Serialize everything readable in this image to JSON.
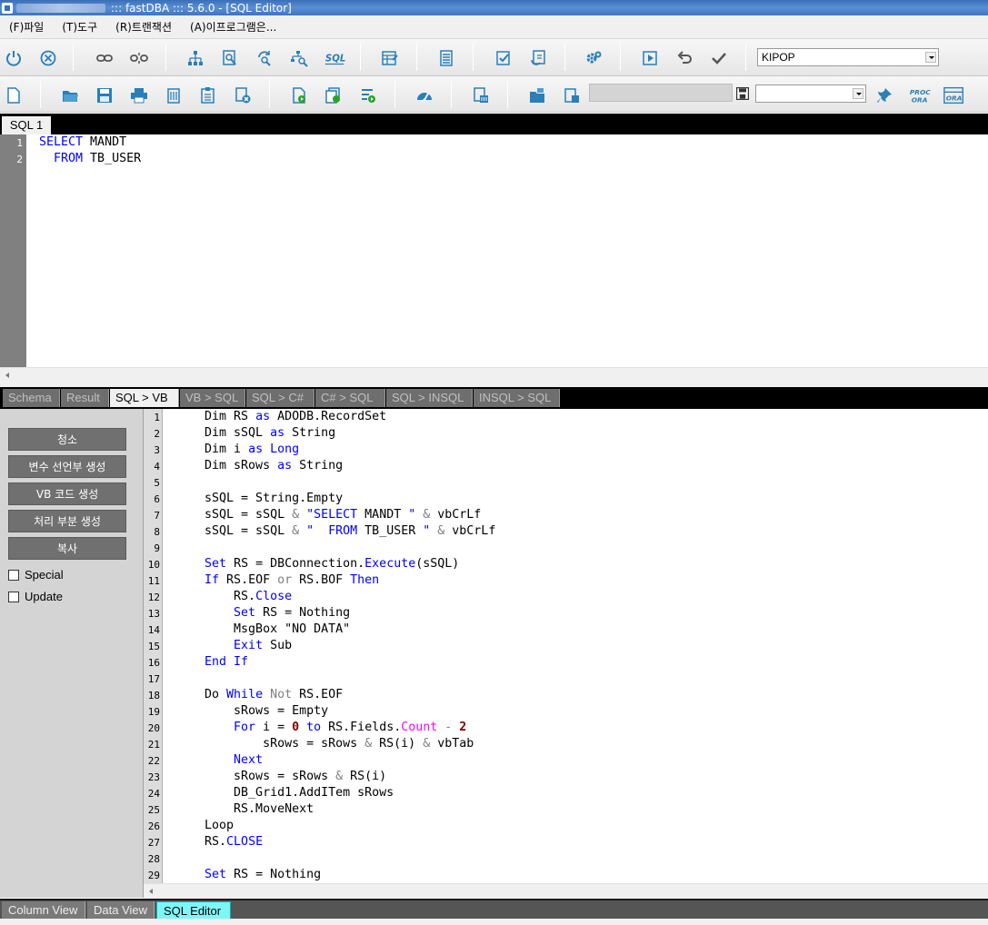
{
  "window": {
    "title": "::: fastDBA ::: 5.6.0 - [SQL Editor]"
  },
  "menu": [
    {
      "label": "(F)파일"
    },
    {
      "label": "(T)도구"
    },
    {
      "label": "(R)트랜잭션"
    },
    {
      "label": "(A)이프로그램은..."
    }
  ],
  "toolbar1": {
    "icons": [
      "power-icon",
      "cancel-icon",
      "connect-icon",
      "disconnect-icon",
      "tree-icon",
      "find-object-icon",
      "refresh-search-icon",
      "search-tree-icon",
      "sql-icon",
      "table-edit-icon",
      "list-icon",
      "check-doc-icon",
      "sync-doc-icon",
      "settings-icon",
      "run-icon",
      "undo-icon",
      "commit-icon"
    ],
    "connection_select": {
      "value": "KIPOP"
    }
  },
  "toolbar2": {
    "icons": [
      "new-icon",
      "open-icon",
      "save-icon",
      "print-icon",
      "delete-icon",
      "paste-icon",
      "clear-icon",
      "new-run-icon",
      "run-all-icon",
      "run-step-icon",
      "gauge-icon",
      "trash-icon",
      "folder-open-icon",
      "copy-doc-icon",
      "save-small-icon",
      "pin-icon",
      "proc-ora-icon",
      "ora-icon"
    ],
    "path_field": {
      "value": ""
    },
    "second_select": {
      "value": ""
    },
    "proc_label": "PROC",
    "ora_label": "ORA"
  },
  "sql_tabs": [
    {
      "label": "SQL 1"
    }
  ],
  "sql_editor": {
    "lines": [
      {
        "n": "1",
        "html": "<span class=\"kw\">SELECT</span> MANDT"
      },
      {
        "n": "2",
        "html": "  <span class=\"kw\">FROM</span> TB_USER"
      }
    ]
  },
  "bottom_tabs": [
    {
      "label": "Schema",
      "active": false
    },
    {
      "label": "Result",
      "active": false
    },
    {
      "label": "SQL > VB",
      "active": true
    },
    {
      "label": "VB > SQL",
      "active": false
    },
    {
      "label": "SQL > C#",
      "active": false
    },
    {
      "label": "C# > SQL",
      "active": false
    },
    {
      "label": "SQL > INSQL",
      "active": false
    },
    {
      "label": "INSQL > SQL",
      "active": false
    }
  ],
  "left_panel": {
    "buttons": [
      {
        "label": "청소"
      },
      {
        "label": "변수 선언부 생성"
      },
      {
        "label": "VB 코드 생성"
      },
      {
        "label": "처리 부분 생성"
      },
      {
        "label": "복사"
      }
    ],
    "checkboxes": [
      {
        "label": "Special",
        "checked": false
      },
      {
        "label": "Update",
        "checked": false
      }
    ]
  },
  "vb_editor": {
    "lines": [
      {
        "n": "1",
        "html": "    Dim RS <span class=\"kw\">as</span> ADODB.RecordSet"
      },
      {
        "n": "2",
        "html": "    Dim sSQL <span class=\"kw\">as</span> String"
      },
      {
        "n": "3",
        "html": "    Dim i <span class=\"kw\">as</span> <span class=\"kw\">Long</span>"
      },
      {
        "n": "4",
        "html": "    Dim sRows <span class=\"kw\">as</span> String"
      },
      {
        "n": "5",
        "html": ""
      },
      {
        "n": "6",
        "html": "    sSQL = String.Empty"
      },
      {
        "n": "7",
        "html": "    sSQL = sSQL <span class=\"gray\">&amp;</span> <span class=\"str\">\"SELECT</span> MANDT <span class=\"str\">\"</span> <span class=\"gray\">&amp;</span> vbCrLf"
      },
      {
        "n": "8",
        "html": "    sSQL = sSQL <span class=\"gray\">&amp;</span> <span class=\"str\">\"  FROM</span> TB_USER <span class=\"str\">\"</span> <span class=\"gray\">&amp;</span> vbCrLf"
      },
      {
        "n": "9",
        "html": ""
      },
      {
        "n": "10",
        "html": "    <span class=\"kw\">Set</span> RS = DBConnection.<span class=\"kw\">Execute</span>(sSQL)"
      },
      {
        "n": "11",
        "html": "    <span class=\"kw\">If</span> RS.EOF <span class=\"gray\">or</span> RS.BOF <span class=\"kw\">Then</span>"
      },
      {
        "n": "12",
        "html": "        RS.<span class=\"kw\">Close</span>"
      },
      {
        "n": "13",
        "html": "        <span class=\"kw\">Set</span> RS = Nothing"
      },
      {
        "n": "14",
        "html": "        MsgBox \"NO DATA\""
      },
      {
        "n": "15",
        "html": "        <span class=\"kw\">Exit</span> Sub"
      },
      {
        "n": "16",
        "html": "    <span class=\"kw\">End If</span>"
      },
      {
        "n": "17",
        "html": ""
      },
      {
        "n": "18",
        "html": "    Do <span class=\"kw\">While</span> <span class=\"gray\">Not</span> RS.EOF"
      },
      {
        "n": "19",
        "html": "        sRows = Empty"
      },
      {
        "n": "20",
        "html": "        <span class=\"kw\">For</span> i = <span class=\"num\">0</span> <span class=\"kw\">to</span> RS.Fields.<span class=\"mag\">Count</span> <span class=\"gray\">-</span> <span class=\"num\">2</span>"
      },
      {
        "n": "21",
        "html": "            sRows = sRows <span class=\"gray\">&amp;</span> RS(i) <span class=\"gray\">&amp;</span> vbTab"
      },
      {
        "n": "22",
        "html": "        <span class=\"kw\">Next</span>"
      },
      {
        "n": "23",
        "html": "        sRows = sRows <span class=\"gray\">&amp;</span> RS(i)"
      },
      {
        "n": "24",
        "html": "        DB_Grid1.AddITem sRows"
      },
      {
        "n": "25",
        "html": "        RS.MoveNext"
      },
      {
        "n": "26",
        "html": "    Loop"
      },
      {
        "n": "27",
        "html": "    RS.<span class=\"kw\">CLOSE</span>"
      },
      {
        "n": "28",
        "html": ""
      },
      {
        "n": "29",
        "html": "    <span class=\"kw\">Set</span> RS = Nothing"
      }
    ]
  },
  "status_tabs": [
    {
      "label": "Column View",
      "active": false
    },
    {
      "label": "Data View",
      "active": false
    },
    {
      "label": "SQL Editor",
      "active": true
    }
  ]
}
